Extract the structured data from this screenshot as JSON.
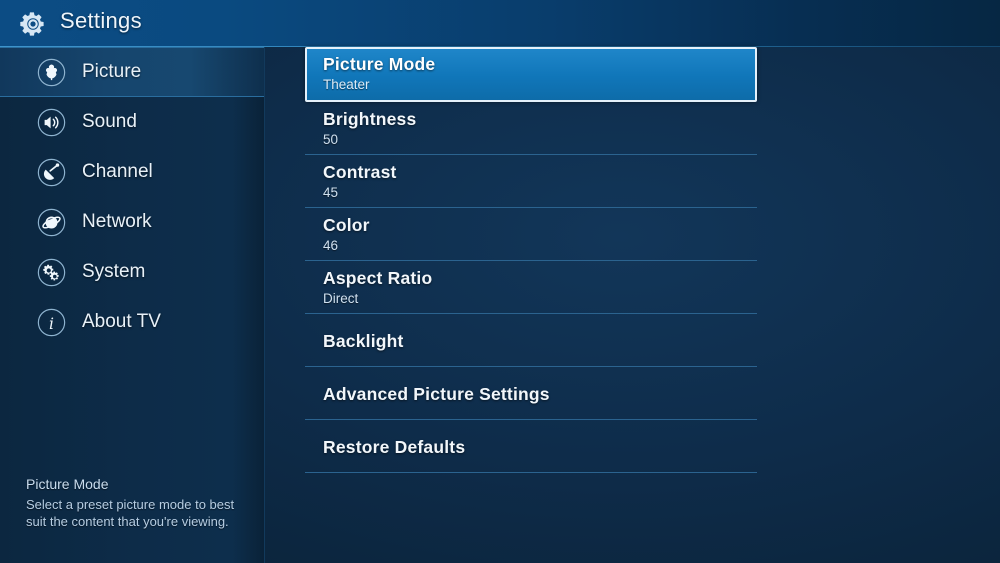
{
  "header": {
    "title": "Settings",
    "icon": "gear-icon"
  },
  "sidebar": {
    "items": [
      {
        "label": "Picture",
        "icon": "flower-icon",
        "selected": true
      },
      {
        "label": "Sound",
        "icon": "speaker-icon",
        "selected": false
      },
      {
        "label": "Channel",
        "icon": "satellite-dish-icon",
        "selected": false
      },
      {
        "label": "Network",
        "icon": "globe-icon",
        "selected": false
      },
      {
        "label": "System",
        "icon": "gears-icon",
        "selected": false
      },
      {
        "label": "About TV",
        "icon": "info-icon",
        "selected": false
      }
    ],
    "help": {
      "title": "Picture Mode",
      "body": "Select a preset picture mode to best suit the content that you're viewing."
    }
  },
  "settings_list": {
    "rows": [
      {
        "label": "Picture Mode",
        "value": "Theater",
        "selected": true
      },
      {
        "label": "Brightness",
        "value": "50",
        "selected": false
      },
      {
        "label": "Contrast",
        "value": "45",
        "selected": false
      },
      {
        "label": "Color",
        "value": "46",
        "selected": false
      },
      {
        "label": "Aspect Ratio",
        "value": "Direct",
        "selected": false
      },
      {
        "label": "Backlight",
        "value": "",
        "selected": false
      },
      {
        "label": "Advanced Picture Settings",
        "value": "",
        "selected": false
      },
      {
        "label": "Restore Defaults",
        "value": "",
        "selected": false
      }
    ]
  },
  "colors": {
    "accent": "#1076b9",
    "header_blue": "#0c4c84",
    "background": "#0e2c4a",
    "separator": "#2b638f",
    "text": "#f2f7fb"
  }
}
